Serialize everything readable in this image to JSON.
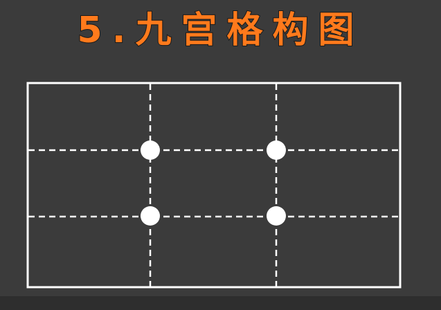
{
  "title": "5.九宫格构图",
  "colors": {
    "background": "#3b3b3b",
    "title": "#ff7a1c",
    "lines": "#ffffff",
    "points": "#ffffff"
  },
  "diagram": {
    "type": "rule-of-thirds-grid",
    "columns": 3,
    "rows": 3,
    "intersections": 4,
    "guide_style": "dashed"
  }
}
